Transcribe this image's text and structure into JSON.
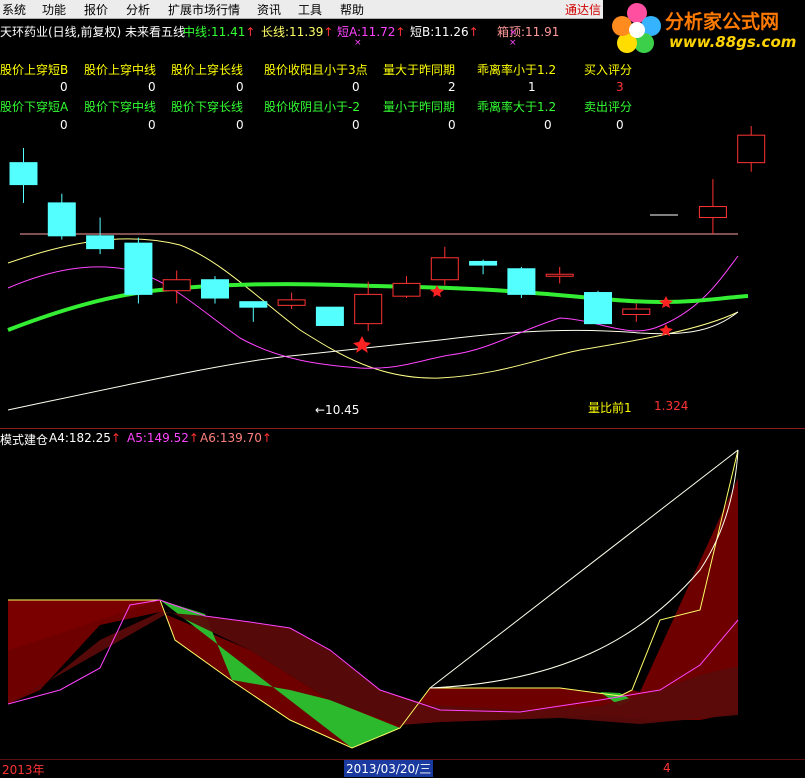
{
  "menu": [
    "系统",
    "功能",
    "报价",
    "分析",
    "扩展市场行情",
    "资讯",
    "工具",
    "帮助"
  ],
  "tdx_label": "通达信",
  "logo": {
    "brand": "分析家公式网",
    "url": "www.88gs.com"
  },
  "header": {
    "title": "天环药业(日线,前复权) 未来看五线",
    "items": [
      {
        "label": "中线:",
        "value": "11.41",
        "arrow": "↑",
        "color": "#33ff33"
      },
      {
        "label": "长线:",
        "value": "11.39",
        "arrow": "↑",
        "color": "#ffff66"
      },
      {
        "label": "短A:",
        "value": "11.72",
        "arrow": "↑",
        "color": "#ff44ff"
      },
      {
        "label": "短B:",
        "value": "11.26",
        "arrow": "↑",
        "color": "#ffffff"
      },
      {
        "label": "箱顶:",
        "value": "11.91",
        "arrow": "",
        "color": "#ff9999"
      }
    ]
  },
  "buy_signals": {
    "headers": [
      "股价上穿短B",
      "股价上穿中线",
      "股价上穿长线",
      "股价收阳且小于3点",
      "量大于昨同期",
      "乖离率小于1.2",
      "买入评分"
    ],
    "values": [
      "0",
      "0",
      "0",
      "0",
      "2",
      "1",
      "3"
    ]
  },
  "sell_signals": {
    "headers": [
      "股价下穿短A",
      "股价下穿中线",
      "股价下穿长线",
      "股价收阴且小于-2",
      "量小于昨同期",
      "乖离率大于1.2",
      "卖出评分"
    ],
    "values": [
      "0",
      "0",
      "0",
      "0",
      "0",
      "0",
      "0"
    ]
  },
  "price_annotations": {
    "low_label": "←10.45",
    "vol_ratio_label": "量比前1",
    "vol_ratio_value": "1.324"
  },
  "sub_indicator": {
    "title": "模式建仓",
    "items": [
      {
        "label": "A4:",
        "value": "182.25",
        "arrow": "↑",
        "color": "#ffffff"
      },
      {
        "label": "A5:",
        "value": "149.52",
        "arrow": "↑",
        "color": "#ff44ff"
      },
      {
        "label": "A6:",
        "value": "139.70",
        "arrow": "↑",
        "color": "#ff8080"
      }
    ]
  },
  "bottom": {
    "year": "2013年",
    "date": "2013/03/20/三",
    "marker": "4"
  },
  "colors": {
    "up": "#ff3333",
    "down": "#54ffff",
    "mid_line": "#33ee33",
    "long_line": "#ffff88",
    "shortA": "#ff44ff",
    "shortB": "#ffffff",
    "box_top": "#ff9999"
  },
  "candles": [
    {
      "o": 11.72,
      "c": 11.6,
      "h": 11.8,
      "l": 11.5,
      "up": false
    },
    {
      "o": 11.5,
      "c": 11.32,
      "h": 11.55,
      "l": 11.3,
      "up": false
    },
    {
      "o": 11.32,
      "c": 11.25,
      "h": 11.42,
      "l": 11.22,
      "up": false
    },
    {
      "o": 11.28,
      "c": 11.0,
      "h": 11.31,
      "l": 10.95,
      "up": false
    },
    {
      "o": 11.02,
      "c": 11.08,
      "h": 11.13,
      "l": 10.95,
      "up": true
    },
    {
      "o": 11.08,
      "c": 10.98,
      "h": 11.1,
      "l": 10.95,
      "up": false
    },
    {
      "o": 10.96,
      "c": 10.93,
      "h": 10.96,
      "l": 10.85,
      "up": false
    },
    {
      "o": 10.94,
      "c": 10.97,
      "h": 11.01,
      "l": 10.92,
      "up": true
    },
    {
      "o": 10.93,
      "c": 10.83,
      "h": 10.93,
      "l": 10.83,
      "up": false
    },
    {
      "o": 10.84,
      "c": 11.0,
      "h": 11.07,
      "l": 10.8,
      "up": true
    },
    {
      "o": 10.99,
      "c": 11.06,
      "h": 11.1,
      "l": 10.98,
      "up": true
    },
    {
      "o": 11.08,
      "c": 11.2,
      "h": 11.26,
      "l": 11.05,
      "up": true
    },
    {
      "o": 11.18,
      "c": 11.16,
      "h": 11.19,
      "l": 11.11,
      "up": false
    },
    {
      "o": 11.14,
      "c": 11.0,
      "h": 11.15,
      "l": 10.98,
      "up": false
    },
    {
      "o": 11.11,
      "c": 11.11,
      "h": 11.15,
      "l": 11.06,
      "up": true
    },
    {
      "o": 11.01,
      "c": 10.84,
      "h": 11.02,
      "l": 10.84,
      "up": false
    },
    {
      "o": 10.89,
      "c": 10.92,
      "h": 10.95,
      "l": 10.85,
      "up": true
    },
    {
      "o": null,
      "c": null,
      "h": null,
      "l": null,
      "up": true
    },
    {
      "o": 11.42,
      "c": 11.48,
      "h": 11.63,
      "l": 11.33,
      "up": true
    },
    {
      "o": 11.72,
      "c": 11.87,
      "h": 11.92,
      "l": 11.67,
      "up": true
    }
  ]
}
